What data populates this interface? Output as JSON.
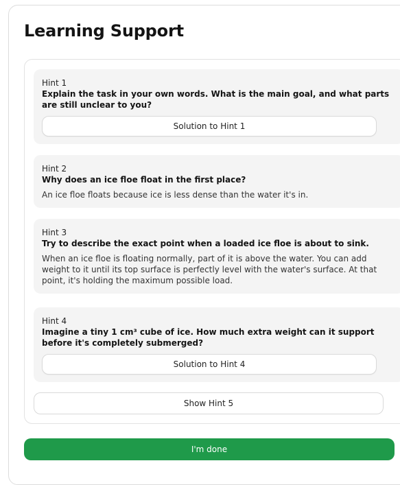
{
  "title": "Learning Support",
  "hints": [
    {
      "label": "Hint 1",
      "question": "Explain the task in your own words. What is the main goal, and what parts are still unclear to you?",
      "solution_button": "Solution to Hint 1"
    },
    {
      "label": "Hint 2",
      "question": "Why does an ice floe float in the first place?",
      "answer": "An ice floe floats because ice is less dense than the water it's in."
    },
    {
      "label": "Hint 3",
      "question": "Try to describe the exact point when a loaded ice floe is about to sink.",
      "answer": "When an ice floe is floating normally, part of it is above the water. You can add weight to it until its top surface is perfectly level with the water's surface. At that point, it's holding the maximum possible load."
    },
    {
      "label": "Hint 4",
      "question": "Imagine a tiny 1 cm³ cube of ice. How much extra weight can it support before it's completely submerged?",
      "solution_button": "Solution to Hint 4"
    }
  ],
  "show_next_button": "Show Hint 5",
  "done_button": "I'm done",
  "colors": {
    "accent": "#1f9a4a",
    "hint_background": "#f4f4f4"
  }
}
